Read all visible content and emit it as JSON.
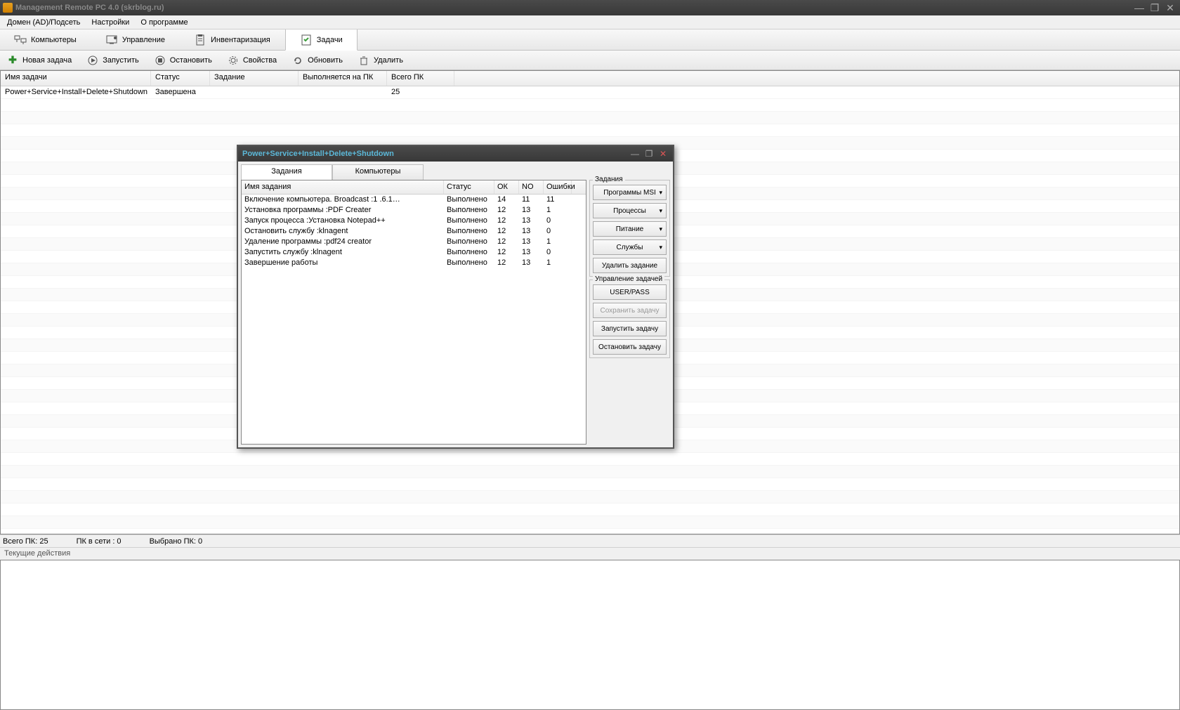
{
  "app_title": "Management Remote PC 4.0 (skrblog.ru)",
  "menubar": [
    "Домен (AD)/Подсеть",
    "Настройки",
    "О программе"
  ],
  "maintabs": [
    {
      "label": "Компьютеры",
      "icon": "computers"
    },
    {
      "label": "Управление",
      "icon": "control"
    },
    {
      "label": "Инвентаризация",
      "icon": "inventory"
    },
    {
      "label": "Задачи",
      "icon": "tasks",
      "active": true
    }
  ],
  "toolbar": [
    {
      "label": "Новая задача",
      "icon": "plus"
    },
    {
      "label": "Запустить",
      "icon": "play"
    },
    {
      "label": "Остановить",
      "icon": "stop"
    },
    {
      "label": "Свойства",
      "icon": "gear"
    },
    {
      "label": "Обновить",
      "icon": "refresh"
    },
    {
      "label": "Удалить",
      "icon": "trash"
    }
  ],
  "columns": [
    "Имя задачи",
    "Статус",
    "Задание",
    "Выполняется на ПК",
    "Всего ПК"
  ],
  "rows": [
    {
      "name": "Power+Service+Install+Delete+Shutdown",
      "status": "Завершена",
      "task": "",
      "running_on": "",
      "total": "25"
    }
  ],
  "status1": {
    "total": "Всего ПК: 25",
    "online": "ПК в сети : 0",
    "selected": "Выбрано ПК: 0"
  },
  "status2": "Текущие действия",
  "dialog": {
    "title": "Power+Service+Install+Delete+Shutdown",
    "tabs": [
      "Задания",
      "Компьютеры"
    ],
    "columns": [
      "Имя задания",
      "Статус",
      "ОК",
      "NO",
      "Ошибки"
    ],
    "rows": [
      {
        "name": "Включение компьютера. Broadcast :1      .6.1…",
        "status": "Выполнено",
        "ok": "14",
        "no": "11",
        "err": "11"
      },
      {
        "name": "Установка программы :PDF Creater",
        "status": "Выполнено",
        "ok": "12",
        "no": "13",
        "err": "1"
      },
      {
        "name": "Запуск процесса :Установка Notepad++",
        "status": "Выполнено",
        "ok": "12",
        "no": "13",
        "err": "0"
      },
      {
        "name": "Остановить службу :klnagent",
        "status": "Выполнено",
        "ok": "12",
        "no": "13",
        "err": "0"
      },
      {
        "name": "Удаление программы :pdf24 creator",
        "status": "Выполнено",
        "ok": "12",
        "no": "13",
        "err": "1"
      },
      {
        "name": "Запустить службу :klnagent",
        "status": "Выполнено",
        "ok": "12",
        "no": "13",
        "err": "0"
      },
      {
        "name": "Завершение работы",
        "status": "Выполнено",
        "ok": "12",
        "no": "13",
        "err": "1"
      }
    ],
    "side": {
      "group1_label": "Задания",
      "group1_buttons": [
        "Программы MSI",
        "Процессы",
        "Питание",
        "Службы",
        "Удалить задание"
      ],
      "group2_label": "Управление задачей",
      "group2_buttons": [
        "USER/PASS",
        "Сохранить задачу",
        "Запустить задачу",
        "Остановить задачу"
      ]
    }
  }
}
